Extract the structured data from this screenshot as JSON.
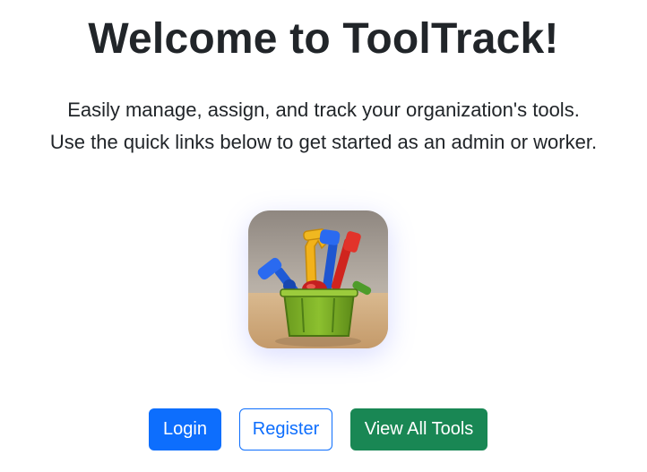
{
  "header": {
    "title": "Welcome to ToolTrack!"
  },
  "intro": {
    "line1": "Easily manage, assign, and track your organization's tools.",
    "line2": "Use the quick links below to get started as an admin or worker."
  },
  "logo": {
    "icon": "toolbox-icon"
  },
  "actions": {
    "login_label": "Login",
    "register_label": "Register",
    "view_tools_label": "View All Tools"
  },
  "colors": {
    "primary": "#0d6efd",
    "success": "#198754",
    "text": "#212529",
    "background": "#ffffff"
  }
}
